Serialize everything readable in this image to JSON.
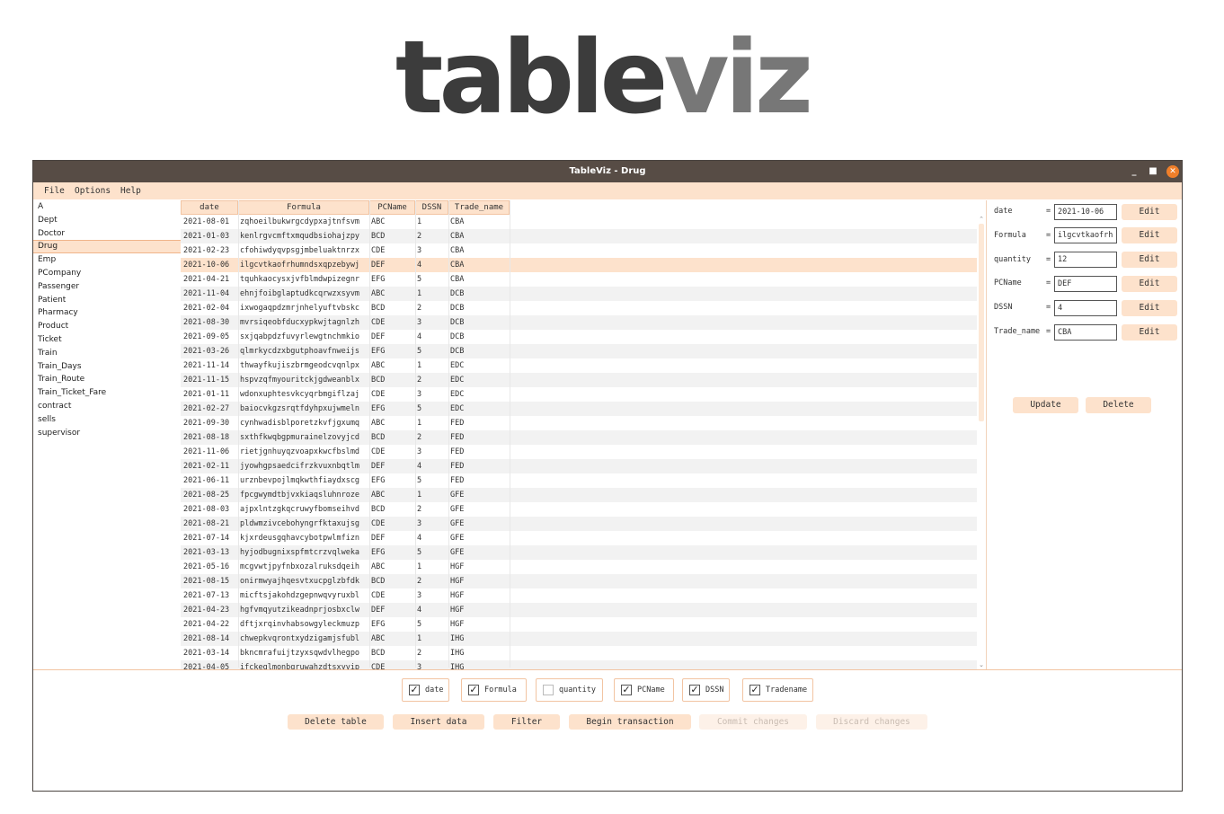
{
  "logo": {
    "part1": "table",
    "part2": "viz"
  },
  "window": {
    "title": "TableViz - Drug",
    "minimize": "_",
    "maximize": "■",
    "close": "✕"
  },
  "menu": [
    "File",
    "Options",
    "Help"
  ],
  "tables": [
    "A",
    "Dept",
    "Doctor",
    "Drug",
    "Emp",
    "PCompany",
    "Passenger",
    "Patient",
    "Pharmacy",
    "Product",
    "Ticket",
    "Train",
    "Train_Days",
    "Train_Route",
    "Train_Ticket_Fare",
    "contract",
    "sells",
    "supervisor"
  ],
  "selected_table": "Drug",
  "columns": [
    "date",
    "Formula",
    "PCName",
    "DSSN",
    "Trade_name"
  ],
  "rows": [
    [
      "2021-08-01",
      "zqhoeilbukwrgcdypxajtnfsvm",
      "ABC",
      "1",
      "CBA"
    ],
    [
      "2021-01-03",
      "kenlrgvcmftxmqudbsiohajzpy",
      "BCD",
      "2",
      "CBA"
    ],
    [
      "2021-02-23",
      "cfohiwdyqvpsgjmbeluaktnrzx",
      "CDE",
      "3",
      "CBA"
    ],
    [
      "2021-10-06",
      "ilgcvtkaofrhumndsxqpzebywj",
      "DEF",
      "4",
      "CBA"
    ],
    [
      "2021-04-21",
      "tquhkaocysxjvfblmdwpizegnr",
      "EFG",
      "5",
      "CBA"
    ],
    [
      "2021-11-04",
      "ehnjfoibglaptudkcqrwzxsyvm",
      "ABC",
      "1",
      "DCB"
    ],
    [
      "2021-02-04",
      "ixwogaqpdzmrjnhelyuftvbskc",
      "BCD",
      "2",
      "DCB"
    ],
    [
      "2021-08-30",
      "mvrsiqeobfducxypkwjtagnlzh",
      "CDE",
      "3",
      "DCB"
    ],
    [
      "2021-09-05",
      "sxjqabpdzfuvyrlewgtnchmkio",
      "DEF",
      "4",
      "DCB"
    ],
    [
      "2021-03-26",
      "qlmrkycdzxbgutphoavfnweijs",
      "EFG",
      "5",
      "DCB"
    ],
    [
      "2021-11-14",
      "thwayfkujiszbrmgeodcvqnlpx",
      "ABC",
      "1",
      "EDC"
    ],
    [
      "2021-11-15",
      "hspvzqfmyouritckjgdweanblx",
      "BCD",
      "2",
      "EDC"
    ],
    [
      "2021-01-11",
      "wdonxuphtesvkcyqrbmgiflzaj",
      "CDE",
      "3",
      "EDC"
    ],
    [
      "2021-02-27",
      "baiocvkgzsrqtfdyhpxujwmeln",
      "EFG",
      "5",
      "EDC"
    ],
    [
      "2021-09-30",
      "cynhwadisblporetzkvfjgxumq",
      "ABC",
      "1",
      "FED"
    ],
    [
      "2021-08-18",
      "sxthfkwqbgpmurainelzovyjcd",
      "BCD",
      "2",
      "FED"
    ],
    [
      "2021-11-06",
      "rietjgnhuyqzvoapxkwcfbslmd",
      "CDE",
      "3",
      "FED"
    ],
    [
      "2021-02-11",
      "jyowhgpsaedcifrzkvuxnbqtlm",
      "DEF",
      "4",
      "FED"
    ],
    [
      "2021-06-11",
      "urznbevpojlmqkwthfiaydxscg",
      "EFG",
      "5",
      "FED"
    ],
    [
      "2021-08-25",
      "fpcgwymdtbjvxkiaqsluhnroze",
      "ABC",
      "1",
      "GFE"
    ],
    [
      "2021-08-03",
      "ajpxlntzgkqcruwyfbomseihvd",
      "BCD",
      "2",
      "GFE"
    ],
    [
      "2021-08-21",
      "pldwmzivcebohyngrfktaxujsg",
      "CDE",
      "3",
      "GFE"
    ],
    [
      "2021-07-14",
      "kjxrdeusgqhavcybotpwlmfizn",
      "DEF",
      "4",
      "GFE"
    ],
    [
      "2021-03-13",
      "hyjodbugnixspfmtcrzvqlweka",
      "EFG",
      "5",
      "GFE"
    ],
    [
      "2021-05-16",
      "mcgvwtjpyfnbxozalruksdqeih",
      "ABC",
      "1",
      "HGF"
    ],
    [
      "2021-08-15",
      "onirmwyajhqesvtxucpglzbfdk",
      "BCD",
      "2",
      "HGF"
    ],
    [
      "2021-07-13",
      "micftsjakohdzgepnwqvyruxbl",
      "CDE",
      "3",
      "HGF"
    ],
    [
      "2021-04-23",
      "hgfvmqyutzikeadnprjosbxclw",
      "DEF",
      "4",
      "HGF"
    ],
    [
      "2021-04-22",
      "dftjxrqinvhabsowgyleckmuzp",
      "EFG",
      "5",
      "HGF"
    ],
    [
      "2021-08-14",
      "chwepkvqrontxydzigamjsfubl",
      "ABC",
      "1",
      "IHG"
    ],
    [
      "2021-03-14",
      "bkncmrafuijtzyxsqwdvlhegpo",
      "BCD",
      "2",
      "IHG"
    ],
    [
      "2021-04-05",
      "ifckeglmonbqruwahzdtsxyvip",
      "CDE",
      "3",
      "IHG"
    ]
  ],
  "selected_row": 3,
  "editor": {
    "fields": [
      {
        "label": "date",
        "value": "2021-10-06"
      },
      {
        "label": "Formula",
        "value": "ilgcvtkaofrh"
      },
      {
        "label": "quantity",
        "value": "12"
      },
      {
        "label": "PCName",
        "value": "DEF"
      },
      {
        "label": "DSSN",
        "value": "4"
      },
      {
        "label": "Trade_name",
        "value": "CBA"
      }
    ],
    "eq": "=",
    "edit_label": "Edit",
    "update_label": "Update",
    "delete_label": "Delete"
  },
  "column_toggles": [
    {
      "label": "date",
      "checked": true
    },
    {
      "label": "Formula",
      "checked": true
    },
    {
      "label": "quantity",
      "checked": false
    },
    {
      "label": "PCName",
      "checked": true
    },
    {
      "label": "DSSN",
      "checked": true
    },
    {
      "label": "Tradename",
      "checked": true
    }
  ],
  "actions": {
    "delete_table": "Delete table",
    "insert_data": "Insert data",
    "filter": "Filter",
    "begin_transaction": "Begin transaction",
    "commit_changes": "Commit changes",
    "discard_changes": "Discard changes"
  },
  "colors": {
    "accent": "#fde2cc",
    "titlebar": "#574c45",
    "close": "#f07f2a"
  }
}
